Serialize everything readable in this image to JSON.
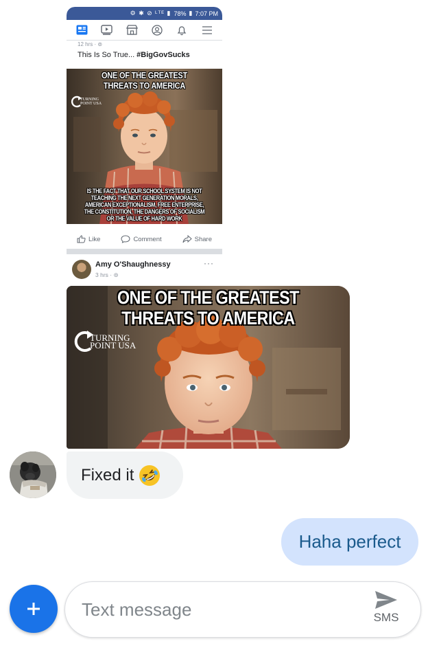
{
  "shared_screenshot": {
    "status_bar": {
      "icons": "⚙ ✱ ⊘ ᴸᵀᴱ ▮",
      "battery": "78%",
      "time": "7:07 PM"
    },
    "nav_icons": [
      "news-feed-icon",
      "watch-icon",
      "marketplace-icon",
      "profile-icon",
      "bell-icon",
      "menu-icon"
    ],
    "post_time": "12 hrs · ",
    "caption_prefix": "This Is So True...",
    "caption_hashtag": "#BigGovSucks",
    "meme": {
      "top_text": "ONE OF THE GREATEST THREATS TO AMERICA",
      "logo_line1": "TURNING",
      "logo_line2": "POINT USA",
      "bottom_text": "IS THE FACT THAT OUR SCHOOL SYSTEM IS NOT TEACHING THE NEXT GENERATION MORALS, AMERICAN EXCEPTIONALISM, FREE ENTERPRISE, THE CONSTITUTION, THE DANGERS OF SOCIALISM OR THE VALUE OF HARD WORK"
    },
    "actions": {
      "like": "Like",
      "comment": "Comment",
      "share": "Share"
    },
    "post2": {
      "author": "Amy O'Shaughnessy",
      "time": "3 hrs · ",
      "more": "···"
    }
  },
  "edited_meme": {
    "top_text_line1": "ONE OF THE GREATEST",
    "top_text_line2": "THREATS TO AMERICA",
    "logo_line1": "TURNING",
    "logo_line2": "POINT USA"
  },
  "messages": [
    {
      "direction": "incoming",
      "text": "Fixed it",
      "emoji": "rolling-on-floor-laughing"
    },
    {
      "direction": "outgoing",
      "text": "Haha perfect"
    }
  ],
  "composer": {
    "placeholder": "Text message",
    "send_label": "SMS"
  },
  "colors": {
    "fb_blue": "#3b5998",
    "outgoing_bubble": "#d3e3fd",
    "outgoing_text": "#1a5a8c",
    "incoming_bubble": "#f1f3f4",
    "fab_blue": "#1a73e8"
  }
}
